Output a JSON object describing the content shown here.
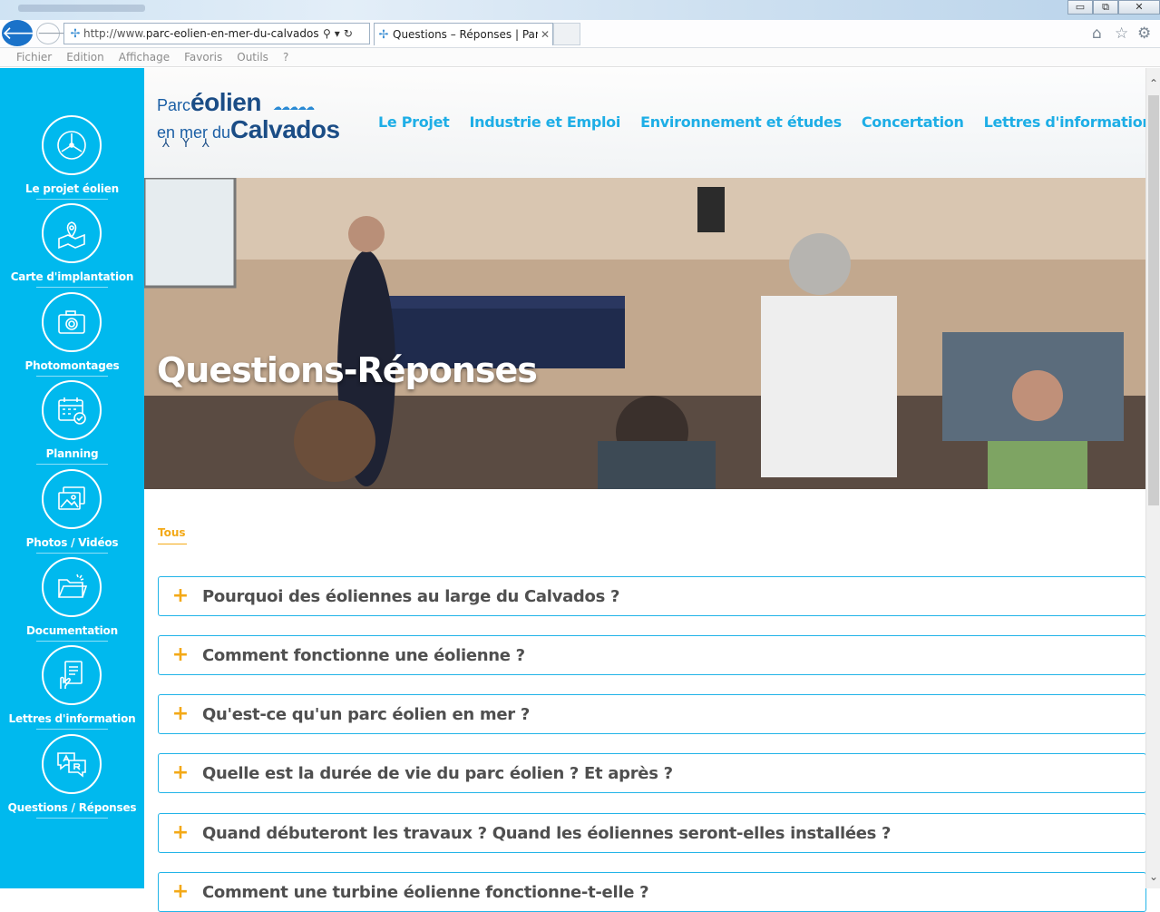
{
  "browser": {
    "address_prefix": "http://www.",
    "address_domain": "parc-eolien-en-mer-du-calvados.fr/",
    "tab_title": "Questions – Réponses | Par...",
    "tab_close": "✕",
    "window_buttons": [
      "▭",
      "⧉",
      "✕"
    ],
    "menu": [
      "Fichier",
      "Edition",
      "Affichage",
      "Favoris",
      "Outils",
      "?"
    ]
  },
  "logo": {
    "line1_small": "Parc",
    "line1_big": "éolien",
    "line2_small": "en mer du",
    "line2_big": "Calvados"
  },
  "topnav": [
    "Le Projet",
    "Industrie et Emploi",
    "Environnement et études",
    "Concertation",
    "Lettres d'information"
  ],
  "sidebar": [
    {
      "label": "Le projet éolien",
      "icon": "turbine-icon"
    },
    {
      "label": "Carte d'implantation",
      "icon": "map-pin-icon"
    },
    {
      "label": "Photomontages",
      "icon": "camera-icon"
    },
    {
      "label": "Planning",
      "icon": "calendar-icon"
    },
    {
      "label": "Photos / Vidéos",
      "icon": "photos-icon"
    },
    {
      "label": "Documentation",
      "icon": "folder-icon"
    },
    {
      "label": "Lettres d'information",
      "icon": "newsletter-icon"
    },
    {
      "label": "Questions / Réponses",
      "icon": "qa-icon"
    }
  ],
  "hero": {
    "title": "Questions-Réponses"
  },
  "filter": {
    "active": "Tous"
  },
  "faq": [
    "Pourquoi des éoliennes au large du Calvados ?",
    "Comment fonctionne une éolienne ?",
    "Qu'est-ce qu'un parc éolien en mer ?",
    "Quelle est la durée de vie du parc éolien ? Et après ?",
    "Quand débuteront les travaux ? Quand les éoliennes seront-elles installées ?",
    "Comment une turbine éolienne fonctionne-t-elle ?"
  ],
  "colors": {
    "sidebar": "#00b9ee",
    "accent": "#f3a917",
    "nav": "#1eaee6",
    "faq_border": "#22b4e8"
  }
}
